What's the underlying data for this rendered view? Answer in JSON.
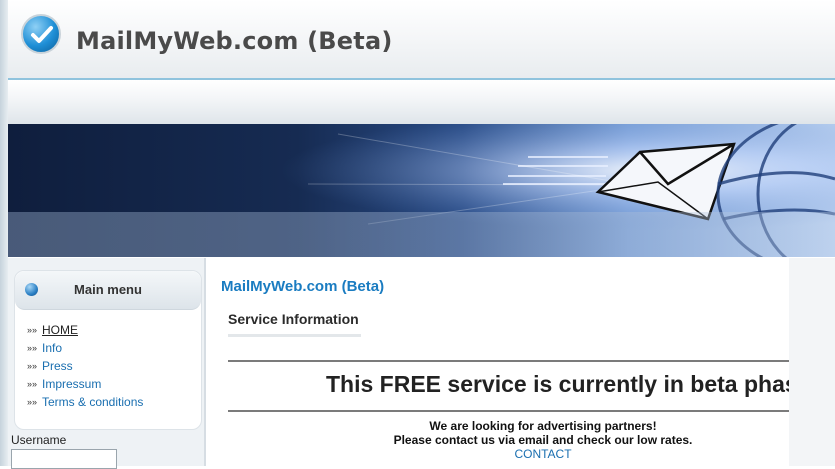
{
  "header": {
    "site_title": "MailMyWeb.com (Beta)",
    "logo_icon": "checkmark-logo-icon"
  },
  "sidebar": {
    "menu_title": "Main menu",
    "items": [
      {
        "label": "HOME",
        "active": true
      },
      {
        "label": "Info",
        "active": false
      },
      {
        "label": "Press",
        "active": false
      },
      {
        "label": "Impressum",
        "active": false
      },
      {
        "label": "Terms & conditions",
        "active": false
      }
    ],
    "username_label": "Username",
    "username_value": ""
  },
  "main": {
    "title": "MailMyWeb.com (Beta)",
    "section": "Service Information",
    "headline": "This FREE service is currently in beta phase",
    "line1": "We are looking for advertising partners!",
    "line2": "Please contact us via email and check our low rates.",
    "contact_link": "CONTACT"
  },
  "colors": {
    "accent_blue": "#1a7cc1",
    "header_rule": "#8fc3dd",
    "banner_dark": "#0f1e3d"
  }
}
